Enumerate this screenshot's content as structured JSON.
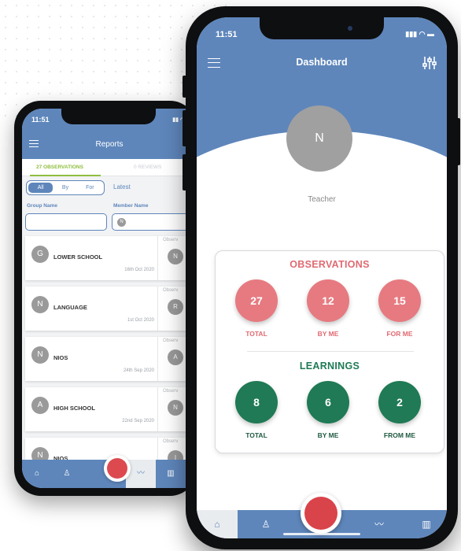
{
  "colors": {
    "header_blue": "#5e86bb",
    "observation_red": "#e67a80",
    "learning_green": "#1f7a55",
    "record_red": "#d9434a",
    "tab_active_green": "#8fbe3f"
  },
  "back_phone": {
    "status_time": "11:51",
    "title": "Reports",
    "tabs": {
      "active": "27 OBSERVATIONS",
      "inactive": "0 REVIEWS"
    },
    "filter_segments": [
      "All",
      "By",
      "For"
    ],
    "latest_label": "Latest",
    "group_name_label": "Group Name",
    "member_name_label": "Member Name",
    "member_avatar_initial": "N",
    "observer_col_label": "Observ",
    "rows": [
      {
        "initial": "G",
        "name": "LOWER SCHOOL",
        "date": "16th Oct 2020",
        "observer_initial": "N"
      },
      {
        "initial": "N",
        "name": "LANGUAGE",
        "date": "1st Oct 2020",
        "observer_initial": "R"
      },
      {
        "initial": "N",
        "name": "NIOS",
        "date": "24th Sep 2020",
        "observer_initial": "A"
      },
      {
        "initial": "A",
        "name": "HIGH SCHOOL",
        "date": "22nd Sep 2020",
        "observer_initial": "N"
      },
      {
        "initial": "N",
        "name": "NIOS",
        "date": "",
        "observer_initial": "I"
      }
    ],
    "nav_icons": [
      "home-icon",
      "person-icon",
      "chart-icon",
      "book-icon"
    ]
  },
  "front_phone": {
    "status_time": "11:51",
    "title": "Dashboard",
    "avatar_initial": "N",
    "role": "Teacher",
    "observations": {
      "title": "OBSERVATIONS",
      "items": [
        {
          "value": "27",
          "label": "TOTAL"
        },
        {
          "value": "12",
          "label": "BY ME"
        },
        {
          "value": "15",
          "label": "FOR ME"
        }
      ]
    },
    "learnings": {
      "title": "LEARNINGS",
      "items": [
        {
          "value": "8",
          "label": "TOTAL"
        },
        {
          "value": "6",
          "label": "BY ME"
        },
        {
          "value": "2",
          "label": "FROM ME"
        }
      ]
    },
    "nav_icons": [
      "home-icon",
      "person-icon",
      "record-button",
      "chart-icon",
      "book-icon"
    ]
  }
}
